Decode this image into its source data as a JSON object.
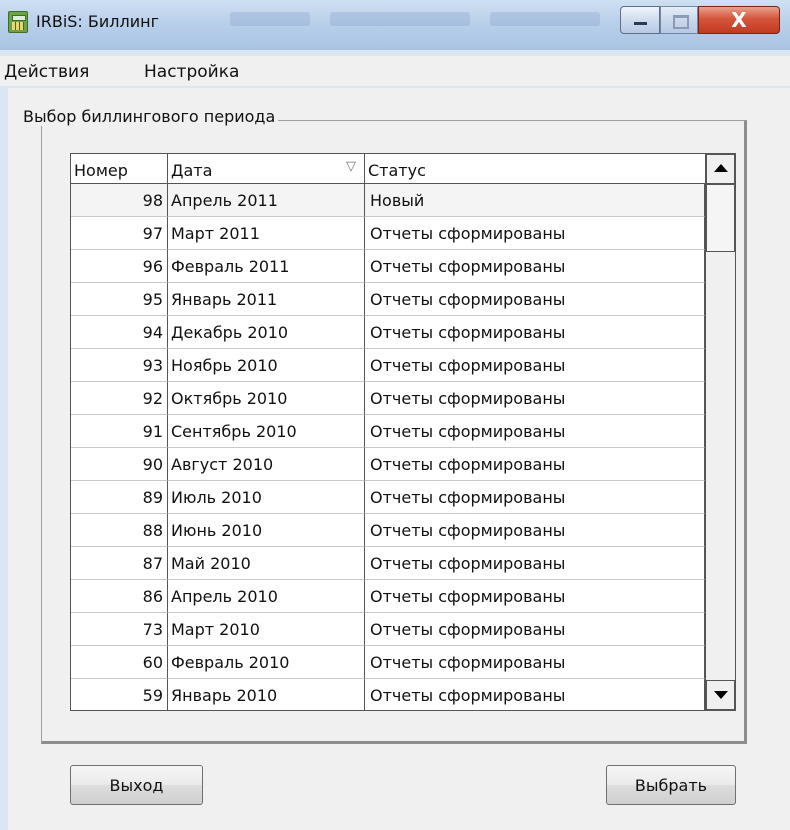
{
  "window": {
    "title": "IRBiS: Биллинг",
    "close_glyph": "X"
  },
  "menu": {
    "items": [
      "Действия",
      "Настройка"
    ]
  },
  "group": {
    "caption": "Выбор биллингового периода"
  },
  "grid": {
    "columns": [
      "Номер",
      "Дата",
      "Статус"
    ],
    "sort_indicator": "▽",
    "rows": [
      {
        "num": "98",
        "date": "Апрель 2011",
        "status": "Новый"
      },
      {
        "num": "97",
        "date": "Март 2011",
        "status": "Отчеты сформированы"
      },
      {
        "num": "96",
        "date": "Февраль 2011",
        "status": "Отчеты сформированы"
      },
      {
        "num": "95",
        "date": "Январь 2011",
        "status": "Отчеты сформированы"
      },
      {
        "num": "94",
        "date": "Декабрь 2010",
        "status": "Отчеты сформированы"
      },
      {
        "num": "93",
        "date": "Ноябрь 2010",
        "status": "Отчеты сформированы"
      },
      {
        "num": "92",
        "date": "Октябрь 2010",
        "status": "Отчеты сформированы"
      },
      {
        "num": "91",
        "date": "Сентябрь 2010",
        "status": "Отчеты сформированы"
      },
      {
        "num": "90",
        "date": "Август 2010",
        "status": "Отчеты сформированы"
      },
      {
        "num": "89",
        "date": "Июль 2010",
        "status": "Отчеты сформированы"
      },
      {
        "num": "88",
        "date": "Июнь 2010",
        "status": "Отчеты сформированы"
      },
      {
        "num": "87",
        "date": "Май 2010",
        "status": "Отчеты сформированы"
      },
      {
        "num": "86",
        "date": "Апрель 2010",
        "status": "Отчеты сформированы"
      },
      {
        "num": "73",
        "date": "Март 2010",
        "status": "Отчеты сформированы"
      },
      {
        "num": "60",
        "date": "Февраль 2010",
        "status": "Отчеты сформированы"
      },
      {
        "num": "59",
        "date": "Январь 2010",
        "status": "Отчеты сформированы"
      }
    ]
  },
  "buttons": {
    "exit_label": "Выход",
    "select_label": "Выбрать"
  },
  "colors": {
    "titlebar": "#b9d0ea",
    "close_button": "#d5553b",
    "dialog_background": "#f0f0f0"
  }
}
